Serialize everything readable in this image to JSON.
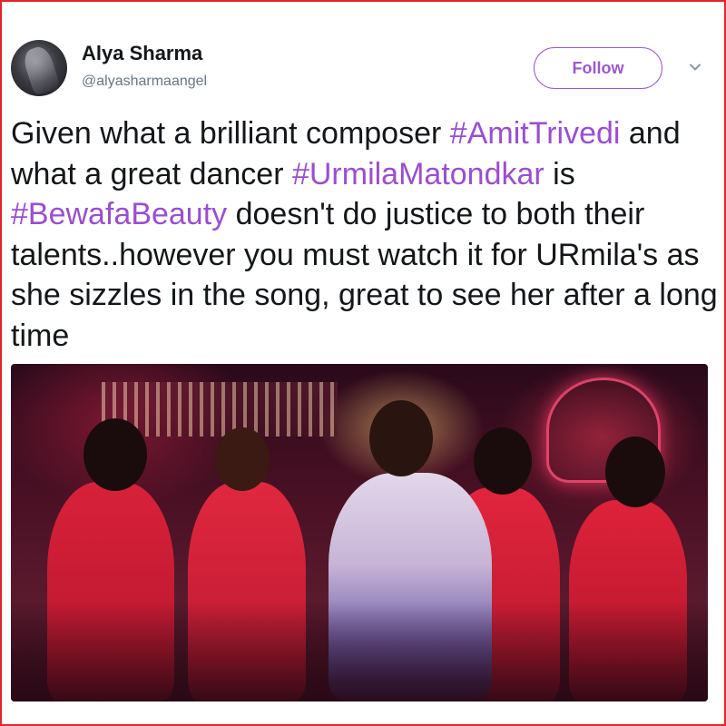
{
  "user": {
    "display_name": "Alya Sharma",
    "handle": "@alyasharmaangel"
  },
  "actions": {
    "follow_label": "Follow",
    "more_icon": "chevron-down-icon"
  },
  "tweet": {
    "segments": [
      {
        "text": "Given what a brilliant composer ",
        "hashtag": false
      },
      {
        "text": "#AmitTrivedi",
        "hashtag": true
      },
      {
        "text": " and what a great dancer ",
        "hashtag": false
      },
      {
        "text": "#UrmilaMatondkar",
        "hashtag": true
      },
      {
        "text": " is ",
        "hashtag": false
      },
      {
        "text": "#BewafaBeauty",
        "hashtag": true
      },
      {
        "text": " doesn't do justice to both their talents..however you must watch it for URmila's as she sizzles in the song, great to see her after a long time",
        "hashtag": false
      }
    ]
  },
  "colors": {
    "hashtag": "#9b4ed0",
    "follow_accent": "#9b59d0",
    "frame_border": "#e0242a"
  }
}
